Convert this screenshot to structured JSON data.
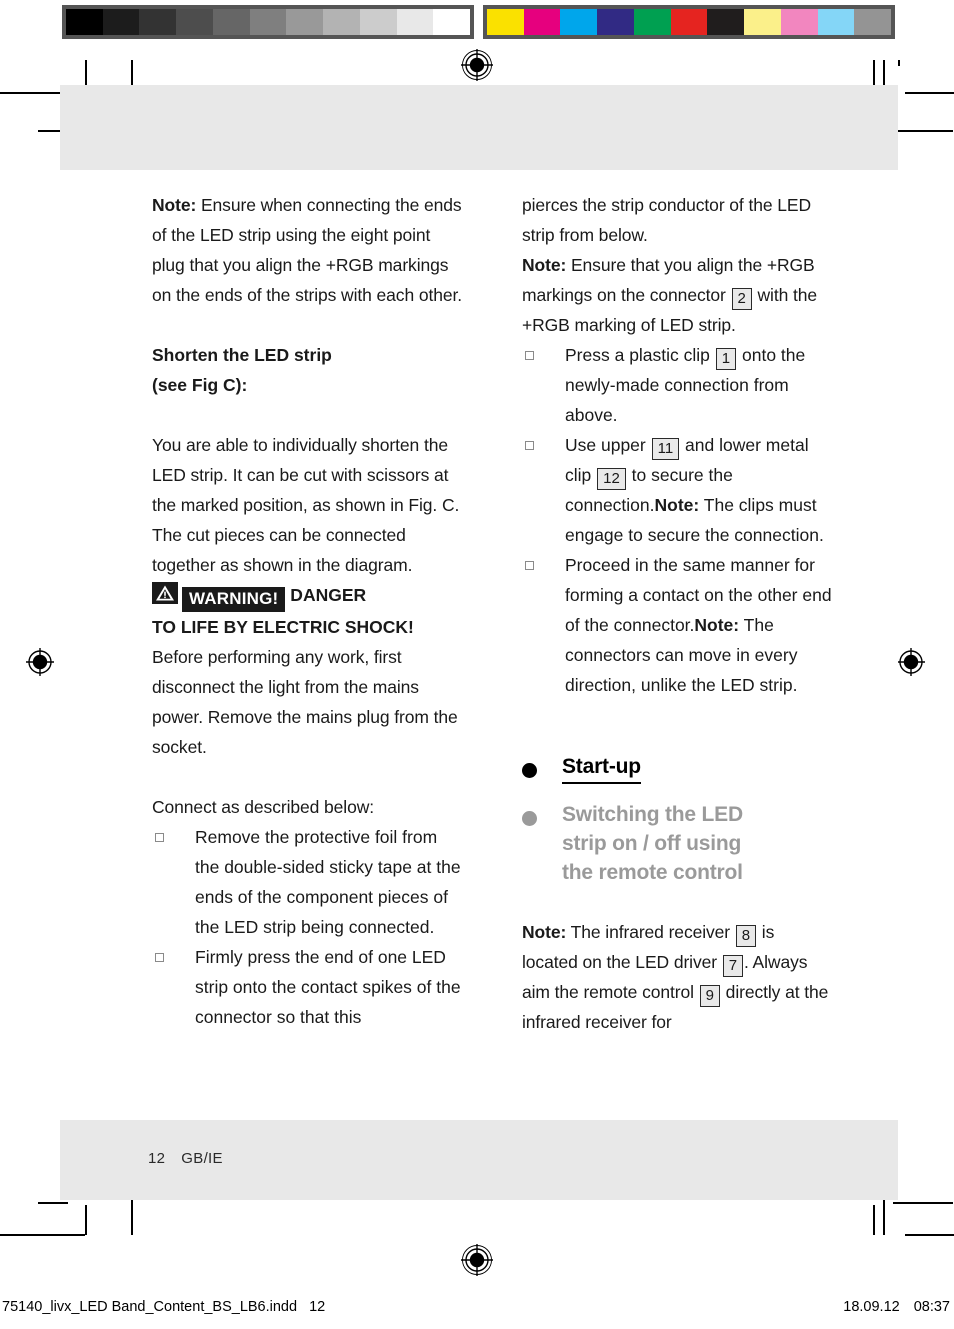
{
  "calibration": {
    "grayscale_swatches": [
      "#000000",
      "#1c1c1c",
      "#333333",
      "#4d4d4d",
      "#666666",
      "#7f7f7f",
      "#999999",
      "#b3b3b3",
      "#cccccc",
      "#e8e8e8",
      "#ffffff"
    ],
    "color_swatches": [
      "#fae100",
      "#e6007e",
      "#00a6eb",
      "#312a84",
      "#00a051",
      "#e52420",
      "#201d1d",
      "#fbf08a",
      "#f286bf",
      "#84d6f7",
      "#949494"
    ]
  },
  "document": {
    "page_number": "12",
    "language_code": "GB/IE"
  },
  "slug": {
    "filename": "75140_livx_LED Band_Content_BS_LB6.indd",
    "page": "12",
    "date": "18.09.12",
    "time": "08:37"
  },
  "left_column": {
    "note1": {
      "lead": "Note:",
      "text": " Ensure when connecting the ends of the LED strip using the eight point plug that you align the +RGB markings on the ends of the strips with each other."
    },
    "heading_shorten_line1": "Shorten the LED strip",
    "heading_shorten_line2": "(see Fig C):",
    "body_shorten": "You are able to individually shorten the LED strip. It can be cut with scissors at the marked position, as shown in Fig. C. The cut pieces can be connected together as shown in the diagram.",
    "warning": {
      "badge": "WARNING!",
      "headline_part1": " DANGER",
      "headline_part2": "TO LIFE BY ELECTRIC SHOCK!"
    },
    "warning_body": "Before performing any work, first disconnect the light from the mains power. Remove the mains plug from the socket.",
    "connect_intro": "Connect as described below:",
    "steps": [
      "Remove the protective foil from the double-sided sticky tape at the ends of the component pieces of the LED strip being connected.",
      "Firmly press the end of one LED strip onto the contact spikes of the connector so that this"
    ]
  },
  "right_column": {
    "continuation": "pierces the strip conductor of the LED strip from below.",
    "note2": {
      "lead": "Note:",
      "part1": " Ensure that you align the +RGB markings on the connector ",
      "ref": "2",
      "part2": " with the +RGB marking of LED strip."
    },
    "step3": {
      "part1": "Press a plastic clip ",
      "ref": "1",
      "part2": " onto the newly-made connection from above."
    },
    "step4": {
      "part1": "Use upper ",
      "ref1": "11",
      "part2": " and lower metal clip ",
      "ref2": "12",
      "part3": " to secure the connection.",
      "note_lead": "Note:",
      "note_text": " The clips must engage to secure the connection."
    },
    "step5": {
      "text": "Proceed in the same manner for forming a contact on the other end of the connector.",
      "note_lead": "Note:",
      "note_text": " The connectors can move in every direction, unlike the LED strip."
    },
    "section_startup": "Start-up",
    "section_switching_line1": "Switching the LED",
    "section_switching_line2": "strip on / off using",
    "section_switching_line3": "the remote control",
    "note3": {
      "lead": "Note:",
      "part1": " The infrared receiver ",
      "ref1": "8",
      "part2": " is located on the LED driver ",
      "ref2": "7",
      "part3": ". Always aim the remote control ",
      "ref3": "9",
      "part4": " directly at the infrared receiver for"
    }
  },
  "colors": {
    "page_bleed": "#e8e8e8",
    "text": "#1a1a1a",
    "gray_heading": "#9a9a9a",
    "ref_box_fill": "#e9e9e9"
  }
}
